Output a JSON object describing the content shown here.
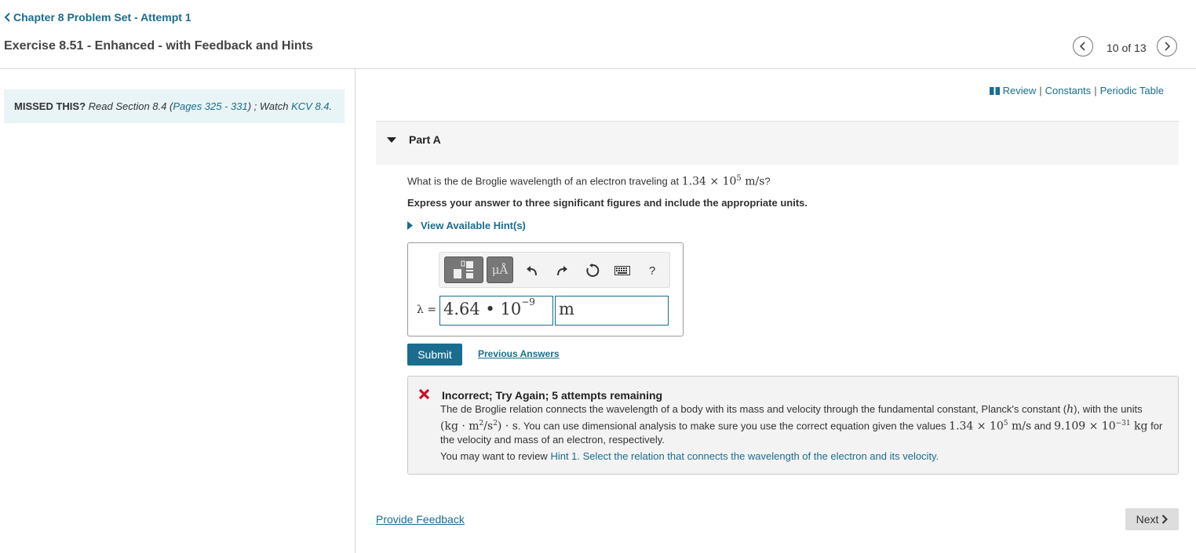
{
  "header": {
    "back_label": "Chapter 8 Problem Set - Attempt 1",
    "exercise_title": "Exercise 8.51 - Enhanced - with Feedback and Hints",
    "pager": "10 of 13"
  },
  "missed": {
    "prefix": "MISSED THIS?",
    "read": "Read Section 8.4 (",
    "pages_link": "Pages 325 - 331",
    "middle": ") ; Watch ",
    "kcv_link": "KCV 8.4",
    "end": "."
  },
  "resources": {
    "review": "Review",
    "constants": "Constants",
    "periodic_table": "Periodic Table",
    "separator": "|"
  },
  "part": {
    "label": "Part A",
    "question_prefix": "What is the de Broglie wavelength of an electron traveling at ",
    "question_math": "1.34 × 10",
    "question_exp": "5",
    "question_unit": " m/s",
    "question_suffix": "?",
    "instruction": "Express your answer to three significant figures and include the appropriate units.",
    "hints_label": "View Available Hint(s)"
  },
  "answer": {
    "variable_label": "λ =",
    "value_mantissa": "4.64 • 10",
    "value_exponent": "−9",
    "unit": "m",
    "toolbar_units": "μÅ",
    "toolbar_help": "?"
  },
  "actions": {
    "submit": "Submit",
    "previous_answers": "Previous Answers"
  },
  "feedback": {
    "title": "Incorrect; Try Again; 5 attempts remaining",
    "line1": "The de Broglie relation connects the wavelength of a body with its mass and velocity through the fundamental constant, Planck's constant (",
    "h": "h",
    "line1_end": "), with the units",
    "units_math": "(kg · m",
    "units_math_2": "/s",
    "units_math_3": ") · s",
    "line2": ". You can use dimensional analysis to make sure you use the correct equation given the values ",
    "v_math": "1.34 × 10",
    "v_exp": "5",
    "v_unit": " m/s",
    "and": " and ",
    "m_math": "9.109 × 10",
    "m_exp": "−31",
    "m_unit": " kg",
    "line3": " for the velocity and mass of an electron, respectively.",
    "review_prefix": "You may want to review ",
    "review_link": "Hint 1. Select the relation that connects the wavelength of the electron and its velocity."
  },
  "footer": {
    "provide_feedback": "Provide Feedback",
    "next": "Next"
  },
  "colors": {
    "link": "#1a6d8f",
    "banner_bg": "#e8f4f6",
    "error_red": "#c8102e"
  }
}
